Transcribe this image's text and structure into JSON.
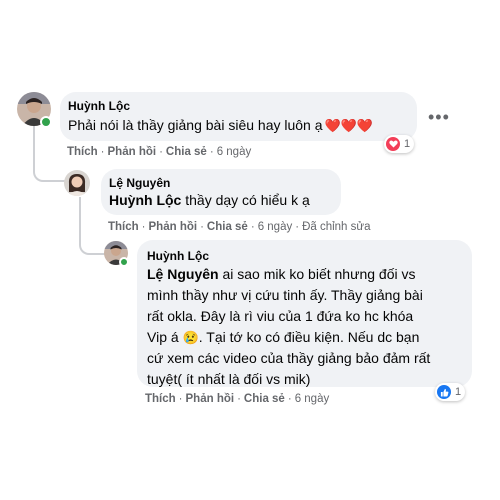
{
  "comments": [
    {
      "author": "Huỳnh Lộc",
      "text": "Phải nói là thầy giảng bài siêu hay luôn ạ",
      "emoji": "❤️❤️❤️",
      "reaction_count": "1",
      "reaction_type": "love-icon",
      "actions": {
        "like": "Thích",
        "reply": "Phản hồi",
        "share": "Chia sẻ",
        "time": "6 ngày"
      }
    },
    {
      "author": "Lệ Nguyên",
      "mention": "Huỳnh Lộc",
      "text": " thầy dạy có hiểu k ạ",
      "actions": {
        "like": "Thích",
        "reply": "Phản hồi",
        "share": "Chia sẻ",
        "time": "6 ngày",
        "edited": "Đã chỉnh sửa"
      }
    },
    {
      "author": "Huỳnh Lộc",
      "mention": "Lệ Nguyên",
      "line1": " ai sao mik ko biết nhưng đối vs",
      "line2": "mình thầy như vị cứu tinh ấy. Thầy giảng bài",
      "line3": "rất okla. Đây là rì viu của 1 đứa ko hc khóa",
      "line4": "Vip á",
      "line4_emoji": "😢",
      "line4_rest": ". Tại tớ ko có điều kiện. Nếu dc bạn",
      "line5": "cứ xem các video của thầy giảng bảo đảm rất",
      "line6": "tuyệt( ít nhất là đối vs mik)",
      "reaction_count": "1",
      "reaction_type": "like-icon",
      "actions": {
        "like": "Thích",
        "reply": "Phản hồi",
        "share": "Chia sẻ",
        "time": "6 ngày"
      }
    }
  ],
  "more_label": "•••",
  "colors": {
    "bubble": "#f0f2f5",
    "meta": "#65676b",
    "love": "#f33e58",
    "like": "#1877f2",
    "online": "#31a24c"
  }
}
